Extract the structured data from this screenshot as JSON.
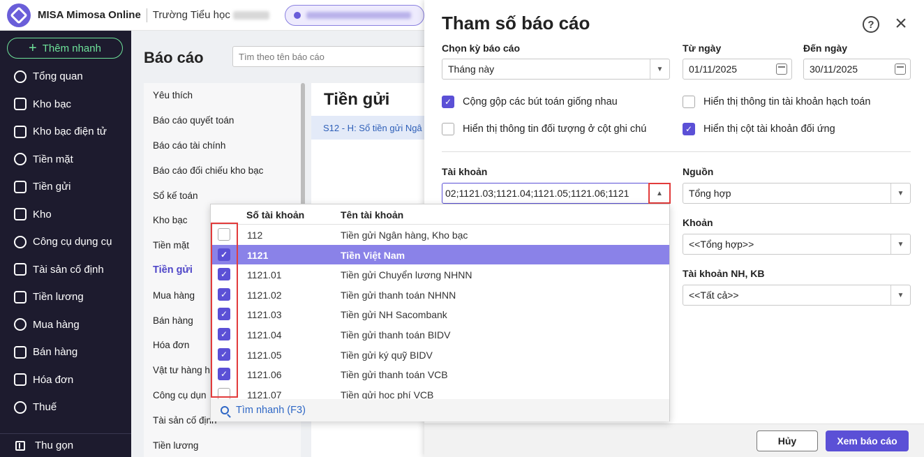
{
  "topbar": {
    "app_name": "MISA Mimosa Online",
    "school": "Trường Tiểu học"
  },
  "sidebar": {
    "add_label": "Thêm nhanh",
    "items": [
      {
        "label": "Tổng quan",
        "icon": "dashboard-icon"
      },
      {
        "label": "Kho bạc",
        "icon": "treasury-icon"
      },
      {
        "label": "Kho bạc điện tử",
        "icon": "e-treasury-icon"
      },
      {
        "label": "Tiền mặt",
        "icon": "cash-icon"
      },
      {
        "label": "Tiền gửi",
        "icon": "deposit-icon"
      },
      {
        "label": "Kho",
        "icon": "warehouse-icon"
      },
      {
        "label": "Công cụ dụng cụ",
        "icon": "tools-icon"
      },
      {
        "label": "Tài sản cố định",
        "icon": "fixed-asset-icon"
      },
      {
        "label": "Tiền lương",
        "icon": "salary-icon"
      },
      {
        "label": "Mua hàng",
        "icon": "cart-icon"
      },
      {
        "label": "Bán hàng",
        "icon": "sales-icon"
      },
      {
        "label": "Hóa đơn",
        "icon": "invoice-icon"
      },
      {
        "label": "Thuế",
        "icon": "tax-icon"
      }
    ],
    "collapse_label": "Thu gọn"
  },
  "main": {
    "title": "Báo cáo",
    "search_placeholder": "Tìm theo tên báo cáo",
    "categories": [
      "Yêu thích",
      "Báo cáo quyết toán",
      "Báo cáo tài chính",
      "Báo cáo đối chiếu kho bạc",
      "Sổ kế toán",
      "Kho bạc",
      "Tiền mặt",
      "Tiền gửi",
      "Mua hàng",
      "Bán hàng",
      "Hóa đơn",
      "Vật tư hàng h",
      "Công cụ dụn",
      "Tài sản cố định",
      "Tiền lương"
    ],
    "active_category_index": 7,
    "report_heading": "Tiền gửi",
    "report_row": "S12 - H: Sổ tiền gửi Ngâ"
  },
  "dialog": {
    "title": "Tham số báo cáo",
    "period_label": "Chọn kỳ báo cáo",
    "period_value": "Tháng này",
    "from_label": "Từ ngày",
    "from_value": "01/11/2025",
    "to_label": "Đến ngày",
    "to_value": "30/11/2025",
    "checks": [
      {
        "label": "Cộng gộp các bút toán giống nhau",
        "checked": true
      },
      {
        "label": "Hiển thị thông tin tài khoản hạch toán",
        "checked": false
      },
      {
        "label": "Hiển thị thông tin đối tượng ở cột ghi chú",
        "checked": false
      },
      {
        "label": "Hiển thị cột tài khoản đối ứng",
        "checked": true
      }
    ],
    "account_label": "Tài khoản",
    "account_value": "02;1121.03;1121.04;1121.05;1121.06;1121",
    "source_label": "Nguồn",
    "source_value": "Tổng hợp",
    "khoan_label": "Khoản",
    "khoan_value": "<<Tổng hợp>>",
    "bank_label": "Tài khoản NH, KB",
    "bank_value": "<<Tất cả>>",
    "cancel_label": "Hủy",
    "view_label": "Xem báo cáo"
  },
  "popup": {
    "col_code": "Số tài khoản",
    "col_name": "Tên tài khoản",
    "rows": [
      {
        "code": "112",
        "name": "Tiền gửi Ngân hàng, Kho bạc",
        "checked": false,
        "selected": false
      },
      {
        "code": "1121",
        "name": "Tiền Việt Nam",
        "checked": true,
        "selected": true
      },
      {
        "code": "1121.01",
        "name": "Tiền gửi Chuyển lương NHNN",
        "checked": true,
        "selected": false
      },
      {
        "code": "1121.02",
        "name": "Tiền gửi thanh toán NHNN",
        "checked": true,
        "selected": false
      },
      {
        "code": "1121.03",
        "name": "Tiền gửi NH Sacombank",
        "checked": true,
        "selected": false
      },
      {
        "code": "1121.04",
        "name": "Tiền gửi thanh toán BIDV",
        "checked": true,
        "selected": false
      },
      {
        "code": "1121.05",
        "name": "Tiền gửi ký quỹ BIDV",
        "checked": true,
        "selected": false
      },
      {
        "code": "1121.06",
        "name": "Tiền gửi thanh toán VCB",
        "checked": true,
        "selected": false
      },
      {
        "code": "1121.07",
        "name": "Tiền gửi học phí VCB",
        "checked": false,
        "selected": false
      }
    ],
    "quick_find": "Tìm nhanh (F3)"
  },
  "colors": {
    "accent": "#5b50d6",
    "sidebar_bg": "#1d1b2e",
    "highlight_red": "#e23b3b",
    "add_green": "#6ee29a"
  }
}
